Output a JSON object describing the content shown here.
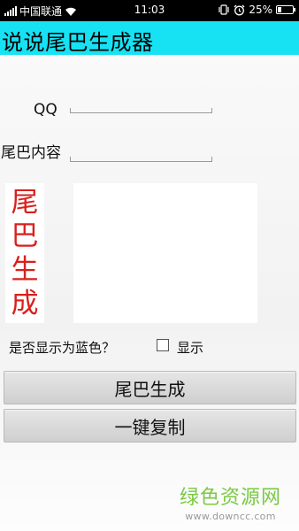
{
  "status_bar": {
    "carrier": "中国联通",
    "time": "11:03",
    "battery": "25%",
    "battery_level": 0.25,
    "icons": [
      "signal-icon",
      "wifi-icon",
      "vibrate-icon",
      "alarm-icon",
      "battery-icon"
    ]
  },
  "app": {
    "title": "说说尾巴生成器",
    "accent_color": "#16e2f3"
  },
  "form": {
    "qq_label": "QQ",
    "qq_value": "",
    "tail_label": "尾巴内容",
    "tail_value": "",
    "result_text": ""
  },
  "vertical_preview": {
    "chars": [
      "尾",
      "巴",
      "生",
      "成"
    ],
    "color": "#d8201c"
  },
  "blue_option": {
    "question": "是否显示为蓝色？",
    "checkbox_label": "显示",
    "checked": false
  },
  "buttons": {
    "generate": "尾巴生成",
    "copy": "一键复制"
  },
  "watermark": {
    "text": "绿色资源网",
    "url": "www.downcc.com"
  }
}
